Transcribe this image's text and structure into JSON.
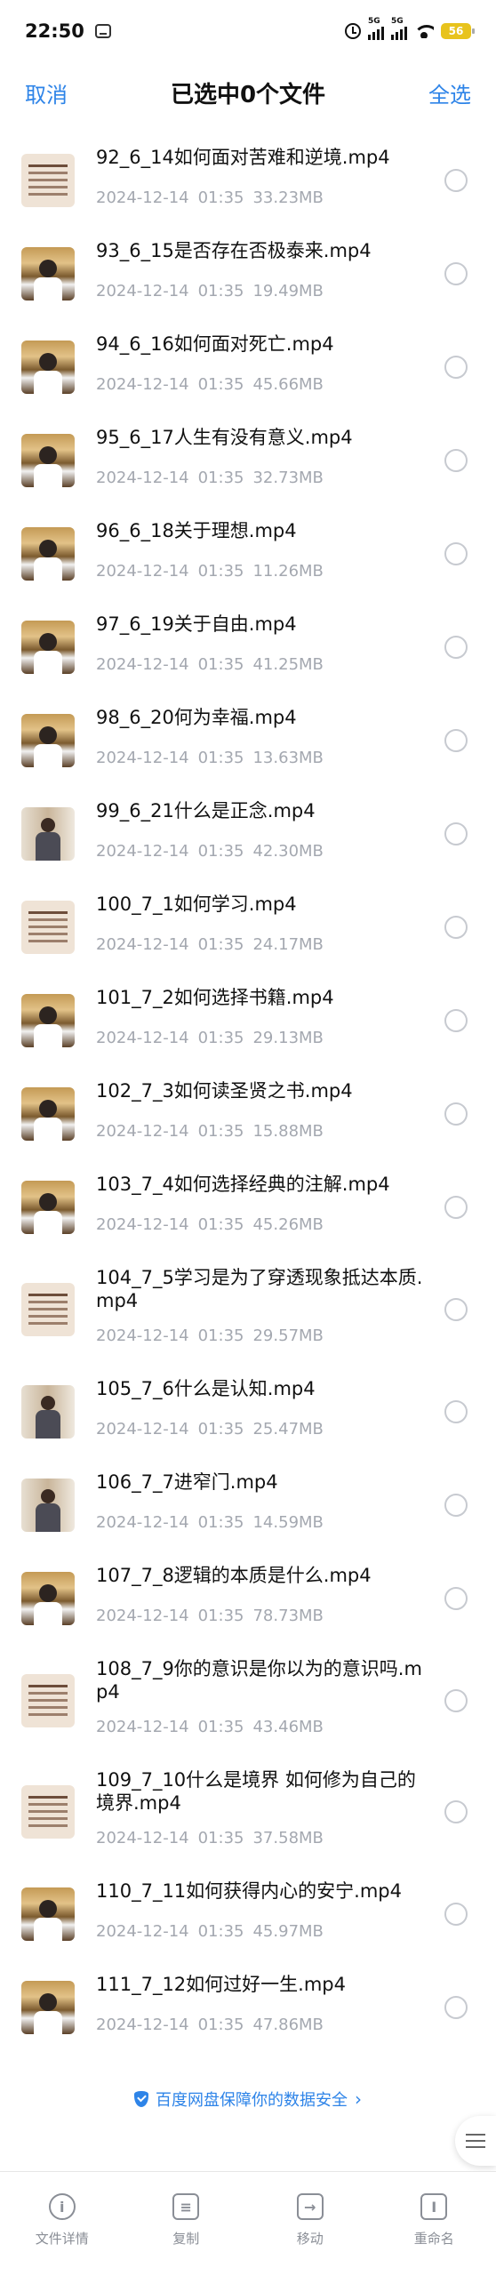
{
  "status_bar": {
    "time": "22:50",
    "signal1_tag": "5G",
    "signal2_tag": "5G",
    "battery": "56",
    "icons": [
      "app-icon",
      "alarm-icon",
      "signal-icon",
      "signal-icon",
      "wifi-icon",
      "battery-icon"
    ]
  },
  "header": {
    "cancel": "取消",
    "title": "已选中0个文件",
    "select_all": "全选"
  },
  "files": [
    {
      "name": "92_6_14如何面对苦难和逆境.mp4",
      "date": "2024-12-14",
      "time": "01:35",
      "size": "33.23MB",
      "thumb": "text"
    },
    {
      "name": "93_6_15是否存在否极泰来.mp4",
      "date": "2024-12-14",
      "time": "01:35",
      "size": "19.49MB",
      "thumb": "room"
    },
    {
      "name": "94_6_16如何面对死亡.mp4",
      "date": "2024-12-14",
      "time": "01:35",
      "size": "45.66MB",
      "thumb": "room"
    },
    {
      "name": "95_6_17人生有没有意义.mp4",
      "date": "2024-12-14",
      "time": "01:35",
      "size": "32.73MB",
      "thumb": "room"
    },
    {
      "name": "96_6_18关于理想.mp4",
      "date": "2024-12-14",
      "time": "01:35",
      "size": "11.26MB",
      "thumb": "room"
    },
    {
      "name": "97_6_19关于自由.mp4",
      "date": "2024-12-14",
      "time": "01:35",
      "size": "41.25MB",
      "thumb": "room"
    },
    {
      "name": "98_6_20何为幸福.mp4",
      "date": "2024-12-14",
      "time": "01:35",
      "size": "13.63MB",
      "thumb": "room"
    },
    {
      "name": "99_6_21什么是正念.mp4",
      "date": "2024-12-14",
      "time": "01:35",
      "size": "42.30MB",
      "thumb": "person"
    },
    {
      "name": "100_7_1如何学习.mp4",
      "date": "2024-12-14",
      "time": "01:35",
      "size": "24.17MB",
      "thumb": "text"
    },
    {
      "name": "101_7_2如何选择书籍.mp4",
      "date": "2024-12-14",
      "time": "01:35",
      "size": "29.13MB",
      "thumb": "room"
    },
    {
      "name": "102_7_3如何读圣贤之书.mp4",
      "date": "2024-12-14",
      "time": "01:35",
      "size": "15.88MB",
      "thumb": "room"
    },
    {
      "name": "103_7_4如何选择经典的注解.mp4",
      "date": "2024-12-14",
      "time": "01:35",
      "size": "45.26MB",
      "thumb": "room"
    },
    {
      "name": "104_7_5学习是为了穿透现象抵达本质.mp4",
      "date": "2024-12-14",
      "time": "01:35",
      "size": "29.57MB",
      "thumb": "text",
      "tall": true
    },
    {
      "name": "105_7_6什么是认知.mp4",
      "date": "2024-12-14",
      "time": "01:35",
      "size": "25.47MB",
      "thumb": "person"
    },
    {
      "name": "106_7_7进窄门.mp4",
      "date": "2024-12-14",
      "time": "01:35",
      "size": "14.59MB",
      "thumb": "person"
    },
    {
      "name": "107_7_8逻辑的本质是什么.mp4",
      "date": "2024-12-14",
      "time": "01:35",
      "size": "78.73MB",
      "thumb": "room"
    },
    {
      "name": "108_7_9你的意识是你以为的意识吗.mp4",
      "date": "2024-12-14",
      "time": "01:35",
      "size": "43.46MB",
      "thumb": "text",
      "tall": true
    },
    {
      "name": "109_7_10什么是境界 如何修为自己的境界.mp4",
      "date": "2024-12-14",
      "time": "01:35",
      "size": "37.58MB",
      "thumb": "text",
      "tall": true
    },
    {
      "name": "110_7_11如何获得内心的安宁.mp4",
      "date": "2024-12-14",
      "time": "01:35",
      "size": "45.97MB",
      "thumb": "room"
    },
    {
      "name": "111_7_12如何过好一生.mp4",
      "date": "2024-12-14",
      "time": "01:35",
      "size": "47.86MB",
      "thumb": "room"
    }
  ],
  "security_banner": "百度网盘保障你的数据安全",
  "bottom_actions": [
    {
      "label": "文件详情",
      "icon": "info-icon",
      "glyph": "i"
    },
    {
      "label": "复制",
      "icon": "copy-icon",
      "glyph": "≡"
    },
    {
      "label": "移动",
      "icon": "move-icon",
      "glyph": "→"
    },
    {
      "label": "重命名",
      "icon": "rename-icon",
      "glyph": "I"
    }
  ],
  "colors": {
    "accent": "#2e84e8",
    "meta_text": "#a4a8b0",
    "battery": "#e8c31c"
  }
}
